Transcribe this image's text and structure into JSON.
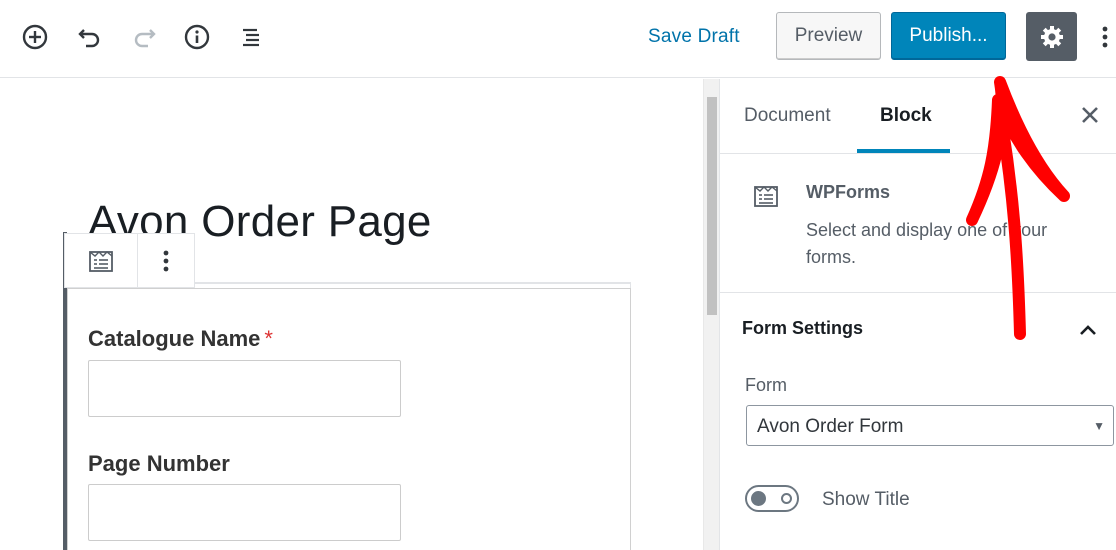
{
  "toolbar": {
    "icons": [
      "add-block-icon",
      "undo-icon",
      "redo-icon",
      "info-icon",
      "outline-icon"
    ],
    "save_draft_label": "Save Draft",
    "preview_label": "Preview",
    "publish_label": "Publish...",
    "settings_icon": "gear-icon",
    "more_icon": "vertical-ellipsis-icon"
  },
  "editor": {
    "post_title": "Avon Order Page",
    "block_toolbar": {
      "type_icon": "wpforms-icon",
      "more_icon": "vertical-ellipsis-icon"
    },
    "form": {
      "fields": [
        {
          "label": "Catalogue Name",
          "required_mark": "*",
          "value": ""
        },
        {
          "label": "Page Number",
          "required_mark": "",
          "value": ""
        }
      ]
    }
  },
  "sidebar": {
    "tabs": [
      {
        "label": "Document",
        "active": false
      },
      {
        "label": "Block",
        "active": true
      }
    ],
    "close_icon": "close-icon",
    "block_card": {
      "icon": "wpforms-icon",
      "title": "WPForms",
      "description": "Select and display one of your forms."
    },
    "panel": {
      "title": "Form Settings",
      "expanded": true,
      "form_label": "Form",
      "form_selected": "Avon Order Form",
      "show_title_label": "Show Title",
      "show_title_on": false
    }
  },
  "colors": {
    "accent": "#0085ba",
    "link": "#0073aa",
    "annotation": "#ff0000",
    "dark_button": "#555d66"
  }
}
